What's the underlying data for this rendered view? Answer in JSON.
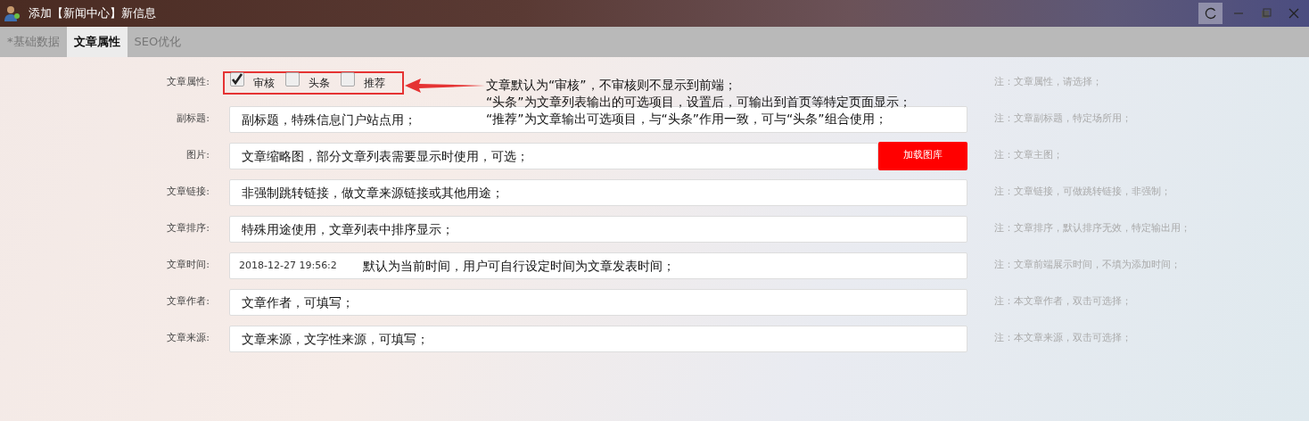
{
  "window": {
    "title": "添加【新闻中心】新信息"
  },
  "tabs": [
    {
      "label": "*基础数据",
      "selected": false
    },
    {
      "label": "文章属性",
      "selected": true
    },
    {
      "label": "SEO优化",
      "selected": false
    }
  ],
  "rows": [
    {
      "kind": "checks",
      "label": "文章属性:",
      "options": [
        {
          "label": "审核",
          "checked": true
        },
        {
          "label": "头条",
          "checked": false
        },
        {
          "label": "推荐",
          "checked": false
        }
      ],
      "note": "注：文章属性，请选择；"
    },
    {
      "kind": "text",
      "label": "副标题:",
      "annotation": "副标题，特殊信息门户站点用；",
      "note": "注：文章副标题，特定场所用；"
    },
    {
      "kind": "image",
      "label": "图片:",
      "annotation": "文章缩略图，部分文章列表需要显示时使用，可选；",
      "button": "加载图库",
      "note": "注：文章主图；"
    },
    {
      "kind": "text",
      "label": "文章链接:",
      "annotation": "非强制跳转链接，做文章来源链接或其他用途；",
      "note": "注：文章链接，可做跳转链接，非强制；"
    },
    {
      "kind": "text",
      "label": "文章排序:",
      "annotation": "特殊用途使用，文章列表中排序显示；",
      "note": "注：文章排序，默认排序无效，特定输出用；"
    },
    {
      "kind": "text",
      "label": "文章时间:",
      "value": "2018-12-27 19:56:2",
      "annotation": "默认为当前时间，用户可自行设定时间为文章发表时间；",
      "note": "注：文章前端展示时间，不填为添加时间；"
    },
    {
      "kind": "text",
      "label": "文章作者:",
      "annotation": "文章作者，可填写；",
      "note": "注：本文章作者，双击可选择；"
    },
    {
      "kind": "text",
      "label": "文章来源:",
      "annotation": "文章来源，文字性来源，可填写；",
      "note": "注：本文章来源，双击可选择；"
    }
  ],
  "callout": {
    "lines": [
      "文章默认为“审核”，不审核则不显示到前端；",
      "“头条”为文章列表输出的可选项目，设置后，可输出到首页等特定页面显示；",
      "“推荐”为文章输出可选项目，与“头条”作用一致，可与“头条”组合使用；"
    ]
  }
}
